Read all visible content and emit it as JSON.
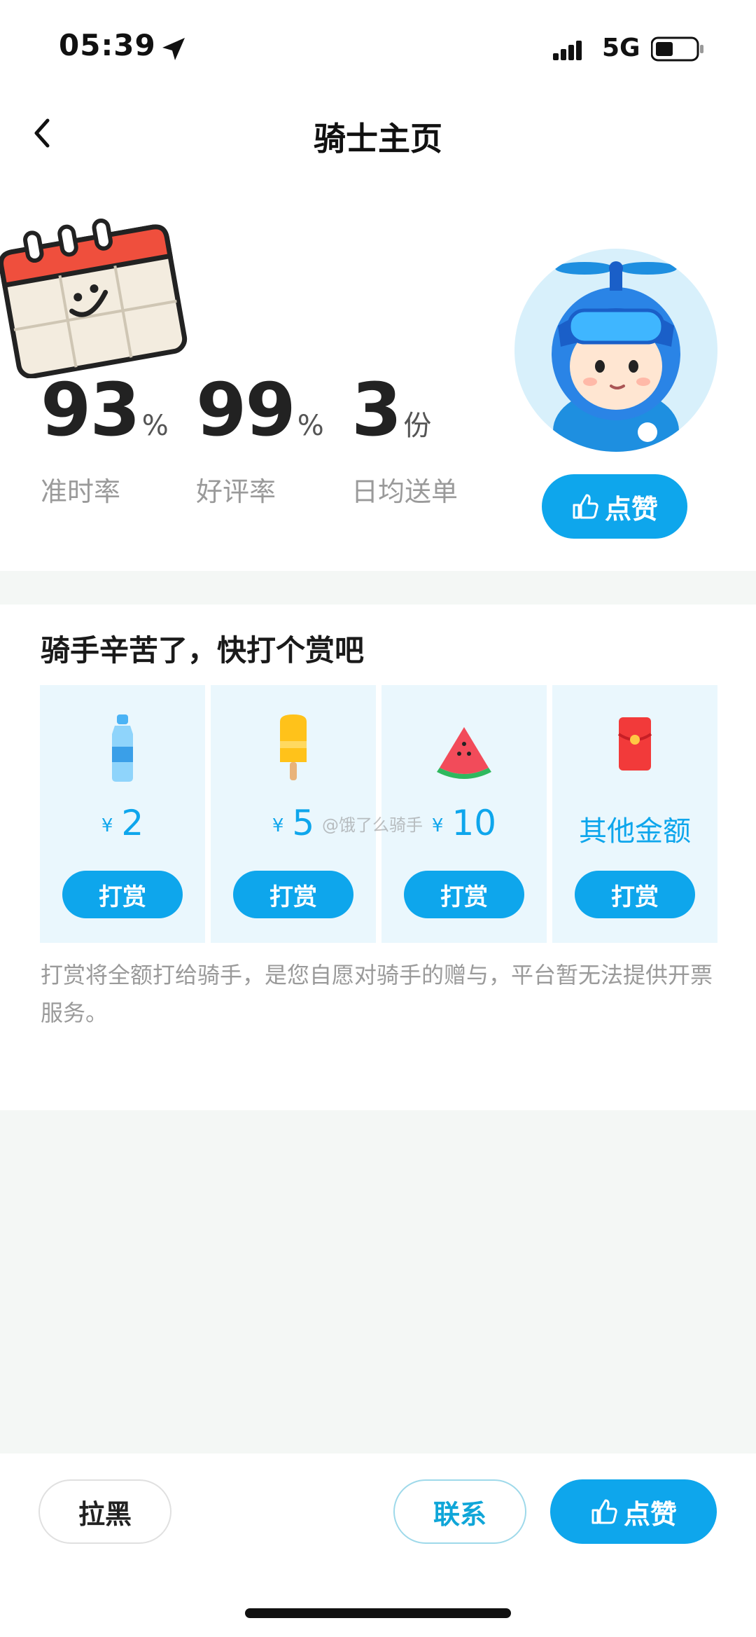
{
  "status_bar": {
    "time": "05:39",
    "network": "5G"
  },
  "header": {
    "title": "骑士主页"
  },
  "stats": [
    {
      "value": "93",
      "unit": "%",
      "label": "准时率"
    },
    {
      "value": "99",
      "unit": "%",
      "label": "好评率"
    },
    {
      "value": "3",
      "unit": "份",
      "label": "日均送单"
    }
  ],
  "like_button": {
    "label": "点赞"
  },
  "tip_section": {
    "title": "骑手辛苦了，快打个赏吧",
    "currency": "¥",
    "options": [
      {
        "amount": "2",
        "icon": "water-bottle-icon",
        "button": "打赏"
      },
      {
        "amount": "5",
        "icon": "popsicle-icon",
        "button": "打赏"
      },
      {
        "amount": "10",
        "icon": "watermelon-icon",
        "button": "打赏"
      },
      {
        "amount": "其他金额",
        "icon": "red-envelope-icon",
        "button": "打赏"
      }
    ],
    "watermark": "@饿了么骑手",
    "note": "打赏将全额打给骑手，是您自愿对骑手的赠与，平台暂无法提供开票服务。"
  },
  "bottom_bar": {
    "block_label": "拉黑",
    "contact_label": "联系",
    "like_label": "点赞"
  },
  "colors": {
    "accent": "#0ea6ec",
    "card_bg": "#eaf7fd",
    "section_bg": "#f4f7f5"
  }
}
